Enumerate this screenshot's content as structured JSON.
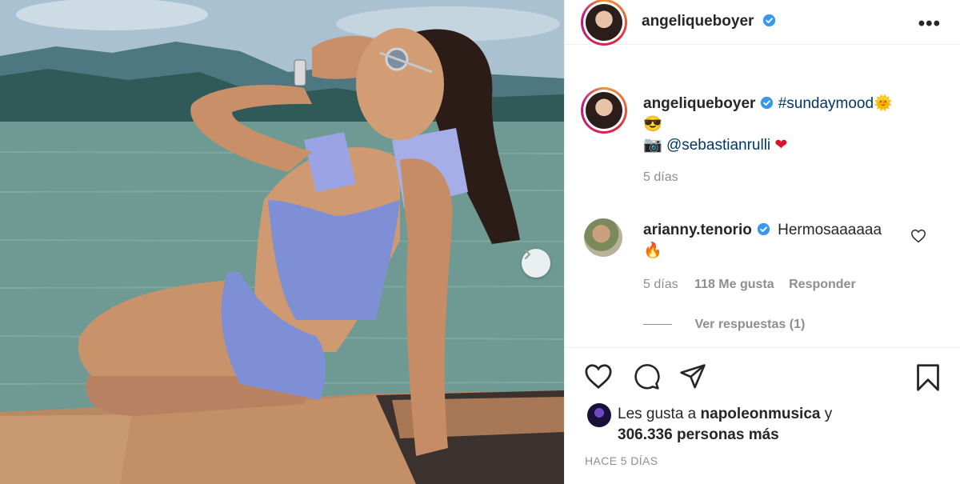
{
  "post": {
    "username": "angeliqueboyer",
    "more_label": "•••",
    "caption": {
      "hashtag": "#sundaymood",
      "line2_emoji": "😎",
      "camera_emoji": "📷",
      "mention": "@sebastianrulli",
      "heart_emoji": "❤",
      "sun_emoji": "🌞",
      "time": "5 días"
    },
    "comment": {
      "username": "arianny.tenorio",
      "text": "Hermosaaaaaa",
      "emoji": "🔥",
      "time": "5 días",
      "likes": "118 Me gusta",
      "reply": "Responder",
      "view_replies": "Ver respuestas (1)"
    },
    "likes": {
      "prefix": "Les gusta a",
      "user": "napoleonmusica",
      "conj": "y",
      "count_text": "306.336 personas más"
    },
    "time_ago": "HACE 5 DÍAS"
  },
  "icons": [
    "heart-icon",
    "comment-icon",
    "share-icon",
    "bookmark-icon",
    "verified-icon",
    "chevron-right-icon"
  ],
  "colors": {
    "link": "#00376b",
    "verified": "#3897f0",
    "muted": "#8e8e8e",
    "text": "#262626"
  }
}
